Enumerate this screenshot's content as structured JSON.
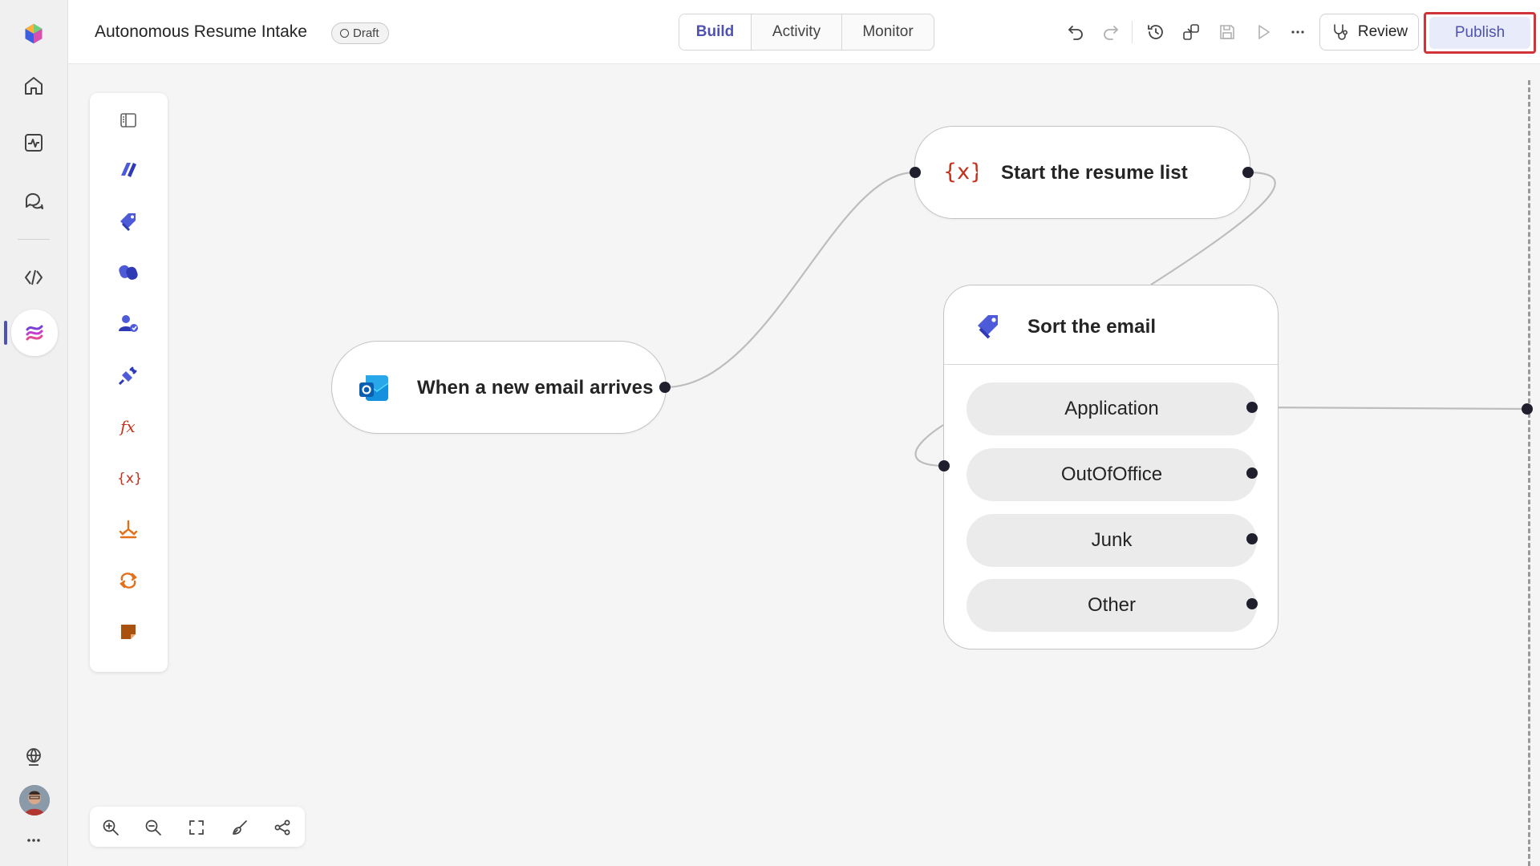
{
  "app": {
    "title": "Autonomous Resume Intake",
    "status": "Draft"
  },
  "tabs": [
    {
      "label": "Build",
      "active": true
    },
    {
      "label": "Activity",
      "active": false
    },
    {
      "label": "Monitor",
      "active": false
    }
  ],
  "toolbar": {
    "review_label": "Review",
    "publish_label": "Publish",
    "icons": [
      "undo-icon",
      "redo-icon",
      "history-icon",
      "connections-icon",
      "save-icon",
      "run-icon",
      "more-icon"
    ]
  },
  "left_rail": {
    "items": [
      "app-logo-icon",
      "home-icon",
      "activity-icon",
      "chat-icon",
      "code-icon",
      "agent-flows-icon",
      "globe-icon",
      "avatar",
      "more-icon"
    ],
    "active": "agent-flows-icon"
  },
  "palette": {
    "items": [
      "collapse-panel-icon",
      "copilot-studio-icon",
      "categorize-icon",
      "copilot-icon",
      "human-in-loop-icon",
      "connector-icon",
      "function-icon",
      "variable-icon",
      "condition-icon",
      "loop-icon",
      "sticky-note-icon"
    ]
  },
  "zoom_controls": [
    "zoom-in-icon",
    "zoom-out-icon",
    "fit-view-icon",
    "tidy-icon",
    "minimap-icon"
  ],
  "nodes": {
    "trigger": {
      "label": "When a new email arrives",
      "icon": "outlook-icon"
    },
    "variable": {
      "label": "Start the resume list",
      "icon": "variable-icon"
    },
    "sort": {
      "label": "Sort the email",
      "icon": "categorize-icon",
      "branches": [
        "Application",
        "OutOfOffice",
        "Junk",
        "Other"
      ]
    }
  },
  "colors": {
    "accent": "#4f52b2",
    "highlight_border": "#d13438",
    "variable_red": "#c4311c",
    "palette_blue": "#4d5bd9",
    "palette_orange": "#e3701b"
  }
}
